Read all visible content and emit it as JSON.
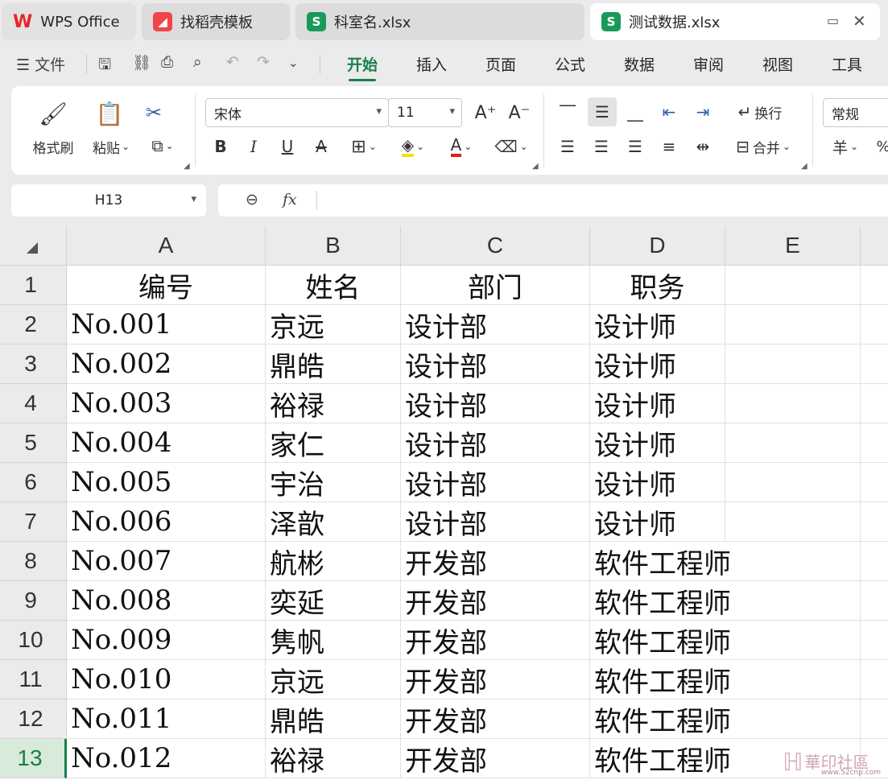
{
  "tabs": [
    {
      "label": "WPS Office",
      "icon": "wps-logo-icon",
      "color": "#e6262e"
    },
    {
      "label": "找稻壳模板",
      "icon": "docer-icon",
      "color": "#f0454b"
    },
    {
      "label": "科室名.xlsx",
      "icon": "spreadsheet-icon",
      "color": "#1a9a5a",
      "glyph": "S"
    },
    {
      "label": "测试数据.xlsx",
      "icon": "spreadsheet-icon",
      "color": "#1a9a5a",
      "glyph": "S",
      "active": true
    }
  ],
  "menu": {
    "file_label": "文件",
    "tabs": [
      "开始",
      "插入",
      "页面",
      "公式",
      "数据",
      "审阅",
      "视图",
      "工具"
    ],
    "active_tab": "开始"
  },
  "ribbon": {
    "format_painter_label": "格式刷",
    "paste_label": "粘贴",
    "font_name": "宋体",
    "font_size": "11",
    "wrap_label": "换行",
    "merge_label": "合并",
    "number_format": "常规",
    "currency_symbol": "羊"
  },
  "formula_bar": {
    "cell_ref": "H13",
    "fx_label": "fx",
    "content": ""
  },
  "sheet": {
    "columns": [
      "A",
      "B",
      "C",
      "D",
      "E"
    ],
    "row_numbers": [
      "1",
      "2",
      "3",
      "4",
      "5",
      "6",
      "7",
      "8",
      "9",
      "10",
      "11",
      "12",
      "13"
    ],
    "selected_row": "13",
    "header": [
      "编号",
      "姓名",
      "部门",
      "职务"
    ],
    "rows": [
      [
        "No.001",
        "京远",
        "设计部",
        "设计师"
      ],
      [
        "No.002",
        "鼎皓",
        "设计部",
        "设计师"
      ],
      [
        "No.003",
        "裕禄",
        "设计部",
        "设计师"
      ],
      [
        "No.004",
        "家仁",
        "设计部",
        "设计师"
      ],
      [
        "No.005",
        "宇治",
        "设计部",
        "设计师"
      ],
      [
        "No.006",
        "泽歆",
        "设计部",
        "设计师"
      ],
      [
        "No.007",
        "航彬",
        "开发部",
        "软件工程师"
      ],
      [
        "No.008",
        "奕延",
        "开发部",
        "软件工程师"
      ],
      [
        "No.009",
        "隽帆",
        "开发部",
        "软件工程师"
      ],
      [
        "No.010",
        "京远",
        "开发部",
        "软件工程师"
      ],
      [
        "No.011",
        "鼎皓",
        "开发部",
        "软件工程师"
      ],
      [
        "No.012",
        "裕禄",
        "开发部",
        "软件工程师"
      ]
    ]
  },
  "watermark": {
    "text": "華印社區",
    "url": "www.52cnp.com"
  },
  "colors": {
    "accent": "#1a7f4c",
    "selected_row_bg": "#d8ead9"
  }
}
